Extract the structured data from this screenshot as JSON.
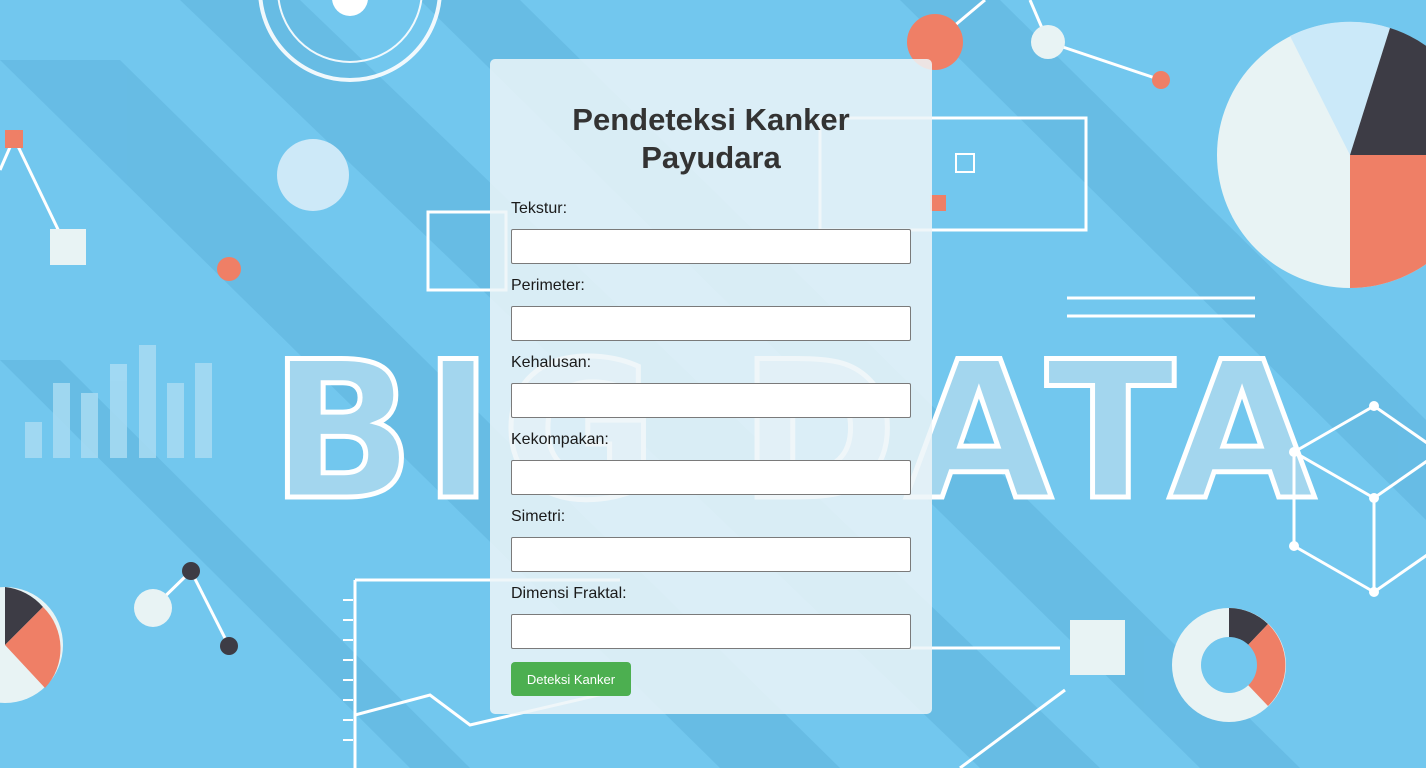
{
  "page": {
    "background_color": "#71c6ec",
    "background_watermark": "BIG DATA"
  },
  "form": {
    "title": "Pendeteksi Kanker Payudara",
    "fields": [
      {
        "label": "Tekstur:",
        "value": ""
      },
      {
        "label": "Perimeter:",
        "value": ""
      },
      {
        "label": "Kehalusan:",
        "value": ""
      },
      {
        "label": "Kekompakan:",
        "value": ""
      },
      {
        "label": "Simetri:",
        "value": ""
      },
      {
        "label": "Dimensi Fraktal:",
        "value": ""
      }
    ],
    "submit_label": "Deteksi Kanker",
    "submit_color": "#4caf50"
  }
}
